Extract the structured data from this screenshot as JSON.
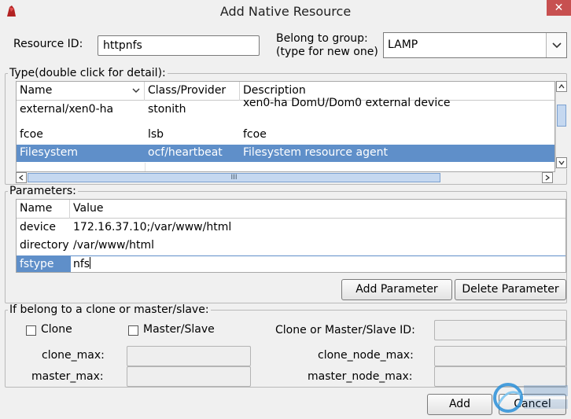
{
  "window": {
    "title": "Add Native Resource",
    "close_glyph": "✕"
  },
  "form": {
    "resource_id_label": "Resource ID:",
    "resource_id_value": "httpnfs",
    "group_label_line1": "Belong to group:",
    "group_label_line2": "(type for new one)",
    "group_value": "LAMP"
  },
  "type_section": {
    "title": "Type(double click for detail):",
    "columns": [
      "Name",
      "Class/Provider",
      "Description"
    ],
    "rows": [
      {
        "name": "external/xen0-ha",
        "provider": "stonith",
        "description": "xen0-ha DomU/Dom0 external device"
      },
      {
        "name": "fcoe",
        "provider": "lsb",
        "description": "fcoe"
      },
      {
        "name": "Filesystem",
        "provider": "ocf/heartbeat",
        "description": "Filesystem resource agent"
      }
    ],
    "selected_row": 2,
    "hscroll_grip": "III"
  },
  "parameters_section": {
    "title": "Parameters:",
    "columns": [
      "Name",
      "Value"
    ],
    "rows": [
      {
        "name": "device",
        "value": "172.16.37.10;/var/www/html"
      },
      {
        "name": "directory",
        "value": "/var/www/html"
      },
      {
        "name": "fstype",
        "value": "nfs"
      }
    ],
    "add_button": "Add Parameter",
    "delete_button": "Delete Parameter"
  },
  "clone_section": {
    "title": "If belong to a clone or master/slave:",
    "clone_label": "Clone",
    "master_slave_label": "Master/Slave",
    "clone_id_label": "Clone or Master/Slave ID:",
    "clone_max_label": "clone_max:",
    "clone_node_max_label": "clone_node_max:",
    "master_max_label": "master_max:",
    "master_node_max_label": "master_node_max:",
    "clone_checked": false,
    "master_slave_checked": false
  },
  "footer": {
    "add_button": "Add",
    "cancel_button": "Cancel"
  },
  "colors": {
    "selection": "#5f8fc9",
    "close_button": "#c75050"
  }
}
